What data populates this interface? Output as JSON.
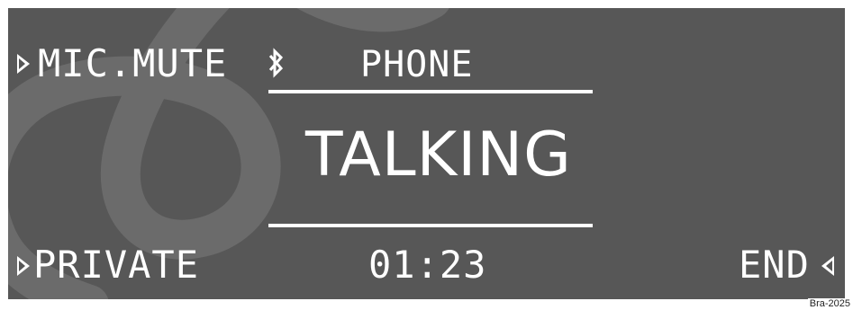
{
  "display": {
    "background": "#575757",
    "foreground": "#ffffff",
    "watermark_color": "#6b6b6b"
  },
  "top_left": {
    "label": "MIC.MUTE",
    "arrow_icon": "triangle-right-outline"
  },
  "status": {
    "bluetooth_icon": "bluetooth-icon",
    "title": "PHONE"
  },
  "call": {
    "state": "TALKING",
    "duration": "01:23"
  },
  "bottom_left": {
    "label": "PRIVATE",
    "arrow_icon": "triangle-right-outline"
  },
  "bottom_right": {
    "label": "END",
    "arrow_icon": "triangle-left-outline"
  },
  "credit": "Bra-2025"
}
